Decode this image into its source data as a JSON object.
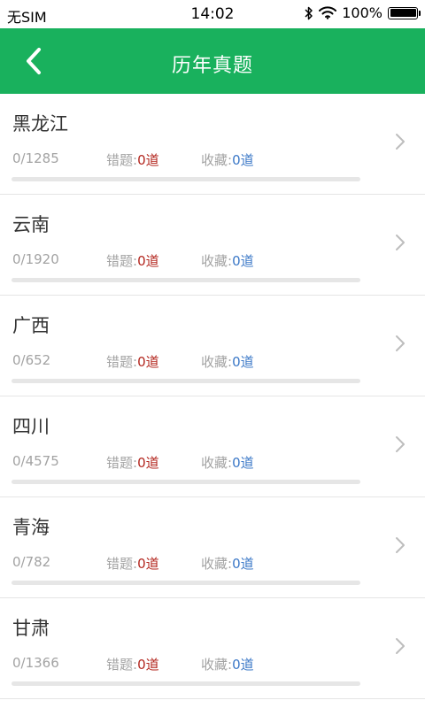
{
  "status_bar": {
    "carrier": "无SIM",
    "time": "14:02",
    "battery": "100%"
  },
  "header": {
    "title": "历年真题"
  },
  "colors": {
    "brand": "#19b15d",
    "wrong_count": "#b3261e",
    "fav_count": "#3b78c7"
  },
  "labels": {
    "wrong": "错题:",
    "fav": "收藏:",
    "unit": "道"
  },
  "items": [
    {
      "name": "黑龙江",
      "progress": "0/1285",
      "wrong": "0",
      "fav": "0",
      "ratio": 0
    },
    {
      "name": "云南",
      "progress": "0/1920",
      "wrong": "0",
      "fav": "0",
      "ratio": 0
    },
    {
      "name": "广西",
      "progress": "0/652",
      "wrong": "0",
      "fav": "0",
      "ratio": 0
    },
    {
      "name": "四川",
      "progress": "0/4575",
      "wrong": "0",
      "fav": "0",
      "ratio": 0
    },
    {
      "name": "青海",
      "progress": "0/782",
      "wrong": "0",
      "fav": "0",
      "ratio": 0
    },
    {
      "name": "甘肃",
      "progress": "0/1366",
      "wrong": "0",
      "fav": "0",
      "ratio": 0
    }
  ]
}
